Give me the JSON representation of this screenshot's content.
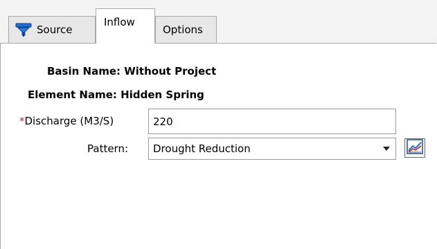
{
  "tabs": {
    "source": "Source",
    "inflow": "Inflow",
    "options": "Options"
  },
  "form": {
    "basin_label": "Basin Name:",
    "basin_value": "Without Project",
    "element_label": "Element Name:",
    "element_value": "Hidden Spring",
    "required_marker": "*",
    "discharge_label": "Discharge (M3/S)",
    "discharge_value": "220",
    "pattern_label": "Pattern:",
    "pattern_value": "Drought Reduction"
  },
  "icons": {
    "source_tab_icon": "source-funnel-icon",
    "pattern_button_icon": "chart-icon",
    "dropdown_icon": "chevron-down-icon"
  },
  "colors": {
    "required_marker": "#e02020",
    "icon_blue": "#1f6fd6",
    "chart_red": "#d23b2b"
  }
}
